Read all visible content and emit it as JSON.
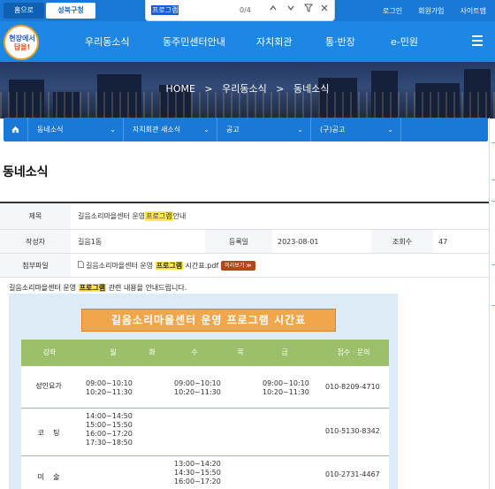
{
  "topbar": {
    "home_label": "홈으로",
    "district_label": "성북구청",
    "links": [
      "로그인",
      "회원가입",
      "사이트맵"
    ]
  },
  "findbar": {
    "query": "프로그램",
    "count": "0/4",
    "icons": [
      "chevron-up-icon",
      "chevron-down-icon",
      "filter-icon",
      "close-icon"
    ]
  },
  "logo": {
    "line1": "현장에서",
    "line2": "답을!"
  },
  "nav": {
    "items": [
      "우리동소식",
      "동주민센터안내",
      "자치회관",
      "통·반장",
      "e-민원"
    ],
    "menu_icon": "hamburger-icon"
  },
  "hero": {
    "breadcrumb": [
      "HOME",
      "우리동소식",
      "동네소식"
    ],
    "separator": ">"
  },
  "subnav": {
    "home_icon": "home-icon",
    "items": [
      "동네소식",
      "자치회관 새소식",
      "공고",
      "(구)공고"
    ]
  },
  "page": {
    "title": "동네소식"
  },
  "post": {
    "title_label": "제목",
    "title_pre": "길음소리마을센터 운영 ",
    "title_hl": "프로그램",
    "title_post": " 안내",
    "author_label": "작성자",
    "author": "길음1동",
    "date_label": "등록일",
    "date": "2023-08-01",
    "views_label": "조회수",
    "views": "47",
    "attach_label": "첨부파일",
    "attach_pre": "길음소리마을센터 운영 ",
    "attach_hl": "프로그램",
    "attach_post": " 시간표.pdf",
    "download_label": "미리보기 ≫"
  },
  "body": {
    "intro_pre": "길음소리마을센터 운영 ",
    "intro_hl": "프로그램",
    "intro_post": " 관련 내용을 안내드립니다."
  },
  "schedule": {
    "title": "길음소리마을센터 운영 프로그램 시간표",
    "headers": [
      "강좌",
      "월",
      "화",
      "수",
      "목",
      "금",
      "접수 · 문의"
    ],
    "rows": [
      {
        "name": "성인요가",
        "mon": [
          "09:00~10:10",
          "10:20~11:30"
        ],
        "wed": [
          "09:00~10:10",
          "10:20~11:30"
        ],
        "fri": [
          "09:00~10:10",
          "10:20~11:30"
        ],
        "contact": "010-8209-4710"
      },
      {
        "name": "코    팅",
        "mon": [
          "14:00~14:50",
          "15:00~15:50",
          "16:00~17:20",
          "17:30~18:50"
        ],
        "wed": [],
        "fri": [],
        "contact": "010-5130-8342"
      },
      {
        "name": "미    술",
        "mon": [],
        "wed": [
          "13:00~14:20",
          "14:30~15:50",
          "16:00~17:20"
        ],
        "fri": [],
        "contact": "010-2731-4467"
      }
    ]
  }
}
